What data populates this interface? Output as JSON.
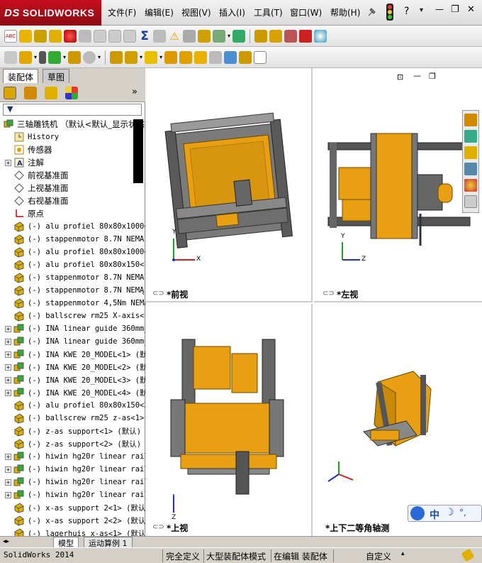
{
  "app": {
    "logo_ds": "DS",
    "logo_text": "SOLIDWORKS"
  },
  "menu": [
    "文件(F)",
    "编辑(E)",
    "视图(V)",
    "插入(I)",
    "工具(T)",
    "窗口(W)",
    "帮助(H)"
  ],
  "window_controls": {
    "help": "?",
    "minimize": "—",
    "restore": "❐",
    "close": "✕"
  },
  "left_tabs": {
    "assembly": "装配体",
    "sketch": "草图"
  },
  "tree": {
    "root": "三轴雕铣机 （默认<默认_显示状态",
    "items": [
      {
        "label": "History",
        "type": "history",
        "exp": false
      },
      {
        "label": "传感器",
        "type": "sensor",
        "exp": false
      },
      {
        "label": "注解",
        "type": "annot",
        "exp": true
      },
      {
        "label": "前视基准面",
        "type": "plane",
        "exp": false
      },
      {
        "label": "上视基准面",
        "type": "plane",
        "exp": false
      },
      {
        "label": "右视基准面",
        "type": "plane",
        "exp": false
      },
      {
        "label": "原点",
        "type": "origin",
        "exp": false
      },
      {
        "label": "(-) alu profiel 80x80x1000<",
        "type": "part",
        "exp": false
      },
      {
        "label": "(-) stappenmotor 8.7N NEMA",
        "type": "part",
        "exp": false
      },
      {
        "label": "(-) alu profiel 80x80x1000<",
        "type": "part",
        "exp": false
      },
      {
        "label": "(-) alu profiel 80x80x150<1",
        "type": "part",
        "exp": false
      },
      {
        "label": "(-) stappenmotor 8.7N NEMA",
        "type": "part",
        "exp": false
      },
      {
        "label": "(-) stappenmotor 8.7N NEMA",
        "type": "part",
        "exp": false
      },
      {
        "label": "(-) stappenmotor 4,5Nm NEMA",
        "type": "part",
        "exp": false
      },
      {
        "label": "(-) ballscrew rm25 X-axis<",
        "type": "part",
        "exp": false
      },
      {
        "label": "(-) INA linear guide 360mm_",
        "type": "asm",
        "exp": true
      },
      {
        "label": "(-) INA linear guide 360mm_",
        "type": "asm",
        "exp": true
      },
      {
        "label": "(-) INA KWE 20_MODEL<1> (默",
        "type": "asm",
        "exp": true
      },
      {
        "label": "(-) INA KWE 20_MODEL<2> (默",
        "type": "asm",
        "exp": true
      },
      {
        "label": "(-) INA KWE 20_MODEL<3> (默",
        "type": "asm",
        "exp": true
      },
      {
        "label": "(-) INA KWE 20_MODEL<4> (默",
        "type": "asm",
        "exp": true
      },
      {
        "label": "(-) alu profiel 80x80x150<2",
        "type": "part",
        "exp": false
      },
      {
        "label": "(-) ballscrew rm25 z-as<1>",
        "type": "part",
        "exp": false
      },
      {
        "label": "(-) z-as support<1> (默认)",
        "type": "part",
        "exp": false
      },
      {
        "label": "(-) z-as support<2> (默认)",
        "type": "part",
        "exp": false
      },
      {
        "label": "(-) hiwin hg20r linear rail",
        "type": "asm",
        "exp": true
      },
      {
        "label": "(-) hiwin hg20r linear rail",
        "type": "asm",
        "exp": true
      },
      {
        "label": "(-) hiwin hg20r linear rail",
        "type": "asm",
        "exp": true
      },
      {
        "label": "(-) hiwin hg20r linear rail",
        "type": "asm",
        "exp": true
      },
      {
        "label": "(-) x-as support 2<1> (默认",
        "type": "part",
        "exp": false
      },
      {
        "label": "(-) x-as support 2<2> (默认",
        "type": "part",
        "exp": false
      },
      {
        "label": "(-) lagerhuis x-as<1> (默认",
        "type": "part",
        "exp": false
      }
    ]
  },
  "viewports": {
    "front": "*前视",
    "left": "*左视",
    "top": "*上视",
    "iso": "*上下二等角轴测"
  },
  "axes": {
    "x": "X",
    "y": "Y",
    "z": "Z"
  },
  "bottom_tabs": {
    "model": "模型",
    "motion": "运动算例 1"
  },
  "status": {
    "app": "SolidWorks 2014",
    "defined": "完全定义",
    "large_mode": "大型装配体模式",
    "editing": "在编辑 装配体",
    "custom": "自定义"
  },
  "ime": {
    "label": "中",
    "moon": "☽",
    "dot": "°,"
  },
  "colors": {
    "accent_red": "#c80f1e",
    "part_orange": "#e8a012",
    "frame_gray": "#6e6e6e",
    "axis_x": "#d02020",
    "axis_y": "#20a020",
    "axis_z": "#2030c0"
  }
}
